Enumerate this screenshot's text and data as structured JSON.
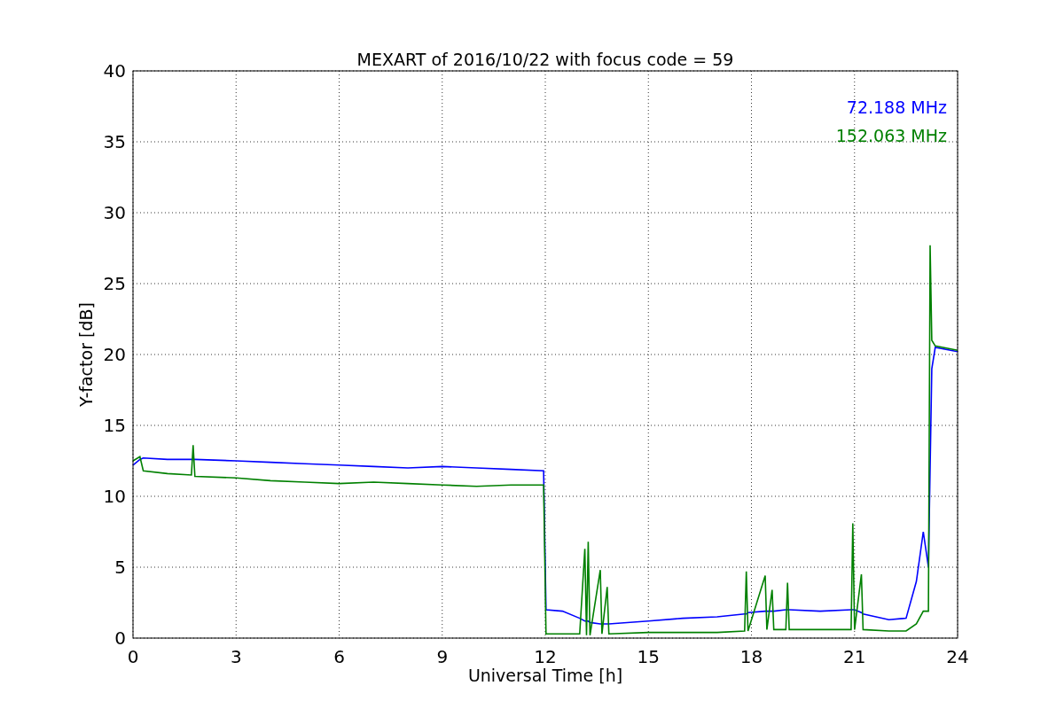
{
  "chart": {
    "chart_data": {
      "type": "line",
      "title": "MEXART of 2016/10/22 with focus code = 59",
      "xlabel": "Universal Time [h]",
      "ylabel": "Y-factor [dB]",
      "x": [
        0,
        0.2,
        0.3,
        1,
        1.7,
        1.75,
        1.8,
        3,
        4,
        5,
        6,
        7,
        8,
        9,
        10,
        11,
        11.95,
        12.02,
        12.5,
        13,
        13.15,
        13.2,
        13.25,
        13.3,
        13.6,
        13.65,
        13.8,
        13.85,
        15,
        16,
        17,
        17.8,
        17.85,
        17.9,
        18.4,
        18.45,
        18.6,
        18.65,
        19,
        19.05,
        19.1,
        20,
        20.9,
        20.95,
        21,
        21.2,
        21.25,
        22,
        22.5,
        22.8,
        23,
        23.15,
        23.2,
        23.25,
        23.35,
        24
      ],
      "series": [
        {
          "name": "72.188 MHz",
          "color": "#0000ff",
          "values": [
            12.2,
            12.6,
            12.7,
            12.6,
            12.6,
            12.6,
            12.6,
            12.5,
            12.4,
            12.3,
            12.2,
            12.1,
            12.0,
            12.1,
            12.0,
            11.9,
            11.8,
            2.0,
            1.9,
            1.4,
            1.2,
            1.2,
            1.2,
            1.1,
            1.0,
            1.0,
            1.0,
            1.0,
            1.2,
            1.4,
            1.5,
            1.7,
            1.7,
            1.8,
            1.9,
            1.9,
            1.9,
            1.9,
            2.0,
            2.0,
            2.0,
            1.9,
            2.0,
            2.0,
            2.0,
            1.8,
            1.7,
            1.3,
            1.4,
            4.0,
            7.5,
            5.0,
            12.0,
            19.0,
            20.5,
            20.2
          ]
        },
        {
          "name": "152.063 MHz",
          "color": "#008000",
          "values": [
            12.5,
            12.8,
            11.8,
            11.6,
            11.5,
            13.6,
            11.4,
            11.3,
            11.1,
            11.0,
            10.9,
            11.0,
            10.9,
            10.8,
            10.7,
            10.8,
            10.8,
            0.3,
            0.3,
            0.3,
            6.3,
            0.2,
            6.8,
            0.2,
            4.8,
            0.3,
            3.6,
            0.3,
            0.4,
            0.4,
            0.4,
            0.5,
            4.7,
            0.5,
            4.4,
            0.6,
            3.4,
            0.6,
            0.6,
            3.9,
            0.6,
            0.6,
            0.6,
            8.1,
            0.6,
            4.5,
            0.6,
            0.5,
            0.5,
            1.0,
            1.9,
            1.9,
            27.7,
            21.0,
            20.6,
            20.3
          ]
        }
      ],
      "grid": true,
      "xlim": [
        0,
        24
      ],
      "ylim": [
        0,
        40
      ],
      "xticks": [
        0,
        3,
        6,
        9,
        12,
        15,
        18,
        21,
        24
      ],
      "yticks": [
        0,
        5,
        10,
        15,
        20,
        25,
        30,
        35,
        40
      ]
    }
  }
}
